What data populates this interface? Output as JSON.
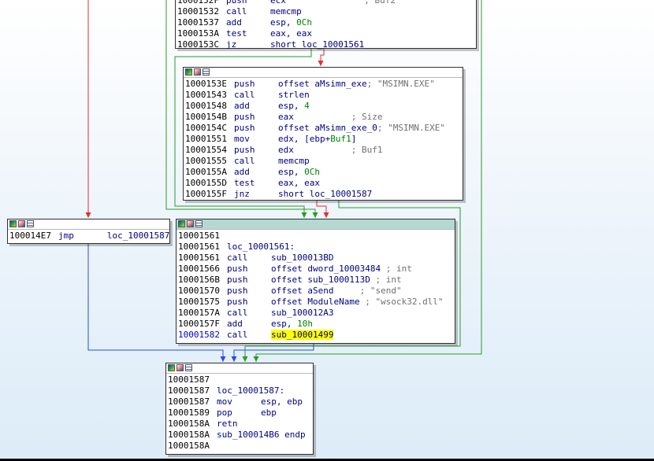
{
  "nodes": {
    "top": {
      "lines": [
        {
          "addr": "10001532",
          "mn": "call",
          "op": "memcmp",
          "cmt": ""
        },
        {
          "addr": "10001537",
          "mn": "add",
          "op": "esp, ",
          "num": "0Ch",
          "cmt": ""
        },
        {
          "addr": "1000153A",
          "mn": "test",
          "op": "eax, eax",
          "cmt": ""
        },
        {
          "addr": "1000153C",
          "mn": "jz",
          "op": "short loc_10001561",
          "cmt": ""
        }
      ]
    },
    "msimn": {
      "lines": [
        {
          "addr": "1000153E",
          "mn": "push",
          "op": "offset aMsimn_exe",
          "cmt": "; \"MSIMN.EXE\""
        },
        {
          "addr": "10001543",
          "mn": "call",
          "op": "strlen",
          "cmt": ""
        },
        {
          "addr": "10001548",
          "mn": "add",
          "op": "esp, ",
          "num": "4",
          "cmt": ""
        },
        {
          "addr": "1000154B",
          "mn": "push",
          "op": "eax",
          "cmt": "           ; Size"
        },
        {
          "addr": "1000154C",
          "mn": "push",
          "op": "offset aMsimn_exe_0",
          "cmt": "; \"MSIMN.EXE\""
        },
        {
          "addr": "10001551",
          "mn": "mov",
          "op": "edx, [ebp+",
          "num": "Buf1",
          "op2": "]",
          "cmt": ""
        },
        {
          "addr": "10001554",
          "mn": "push",
          "op": "edx",
          "cmt": "           ; Buf1"
        },
        {
          "addr": "10001555",
          "mn": "call",
          "op": "memcmp",
          "cmt": ""
        },
        {
          "addr": "1000155A",
          "mn": "add",
          "op": "esp, ",
          "num": "0Ch",
          "cmt": ""
        },
        {
          "addr": "1000155D",
          "mn": "test",
          "op": "eax, eax",
          "cmt": ""
        },
        {
          "addr": "1000155F",
          "mn": "jnz",
          "op": "short loc_10001587",
          "cmt": ""
        }
      ]
    },
    "jmp": {
      "lines": [
        {
          "addr": "100014E7",
          "mn": "jmp",
          "op": "   loc_10001587",
          "cmt": ""
        }
      ]
    },
    "loc1561": {
      "lines": [
        {
          "addr": "10001561",
          "mn": "",
          "op": "",
          "cmt": ""
        },
        {
          "addr": "10001561",
          "mn": "",
          "lbl": "loc_10001561:",
          "op": "",
          "cmt": ""
        },
        {
          "addr": "10001561",
          "mn": "call",
          "op": "sub_100013BD",
          "cmt": ""
        },
        {
          "addr": "10001566",
          "mn": "push",
          "op": "offset dword_10003484",
          "cmt": " ; int"
        },
        {
          "addr": "1000156B",
          "mn": "push",
          "op": "offset sub_1000113D",
          "cmt": " ; int"
        },
        {
          "addr": "10001570",
          "mn": "push",
          "op": "offset aSend",
          "cmt": "     ; \"send\""
        },
        {
          "addr": "10001575",
          "mn": "push",
          "op": "offset ModuleName",
          "cmt": " ; \"wsock32.dll\""
        },
        {
          "addr": "1000157A",
          "mn": "call",
          "op": "sub_100012A3",
          "cmt": ""
        },
        {
          "addr": "1000157F",
          "mn": "add",
          "op": "esp, ",
          "num": "10h",
          "cmt": ""
        },
        {
          "addr": "10001582",
          "mn": "call",
          "hl": "sub",
          "op": "_10001499",
          "cmt": "",
          "addr_link": true
        }
      ]
    },
    "loc1587": {
      "lines": [
        {
          "addr": "10001587",
          "mn": "",
          "op": "",
          "cmt": ""
        },
        {
          "addr": "10001587",
          "mn": "",
          "lbl": "loc_10001587:",
          "op": "",
          "cmt": ""
        },
        {
          "addr": "10001587",
          "mn": "mov",
          "op": "esp, ebp",
          "cmt": ""
        },
        {
          "addr": "10001589",
          "mn": "pop",
          "op": "ebp",
          "cmt": ""
        },
        {
          "addr": "1000158A",
          "mn": "retn",
          "op": "",
          "cmt": ""
        },
        {
          "addr": "1000158A",
          "mn": "",
          "lbl": "sub_100014B6 endp",
          "op": "",
          "cmt": ""
        },
        {
          "addr": "1000158A",
          "mn": "",
          "op": "",
          "cmt": ""
        }
      ]
    }
  },
  "colors": {
    "edge_false": "#e03030",
    "edge_true": "#2a9a2a",
    "edge_uncond": "#2a4de0"
  }
}
